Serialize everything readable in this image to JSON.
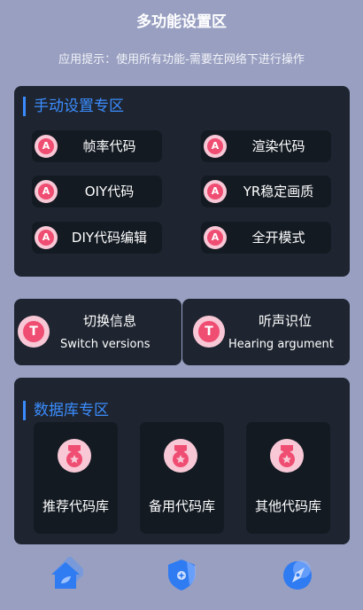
{
  "header": {
    "title": "多功能设置区",
    "hint": "应用提示：使用所有功能-需要在网络下进行操作"
  },
  "manual": {
    "heading": "手动设置专区",
    "badge_letter": "A",
    "buttons": [
      "帧率代码",
      "渲染代码",
      "OIY代码",
      "YR稳定画质",
      "DIY代码编辑",
      "全开模式"
    ]
  },
  "switches": {
    "badge_letter": "T",
    "left": {
      "title": "切换信息",
      "subtitle": "Switch versions"
    },
    "right": {
      "title": "听声识位",
      "subtitle": "Hearing argument"
    }
  },
  "database": {
    "heading": "数据库专区",
    "cards": [
      "推荐代码库",
      "备用代码库",
      "其他代码库"
    ]
  },
  "bottom_nav": {
    "icons": [
      "home-icon",
      "shield-icon",
      "compass-icon"
    ]
  },
  "colors": {
    "background": "#989fc1",
    "panel": "#1e2530",
    "button": "#131a22",
    "accent": "#3b8dff",
    "badge": "#ef4d72",
    "badge_ring": "#f8c8d6"
  }
}
